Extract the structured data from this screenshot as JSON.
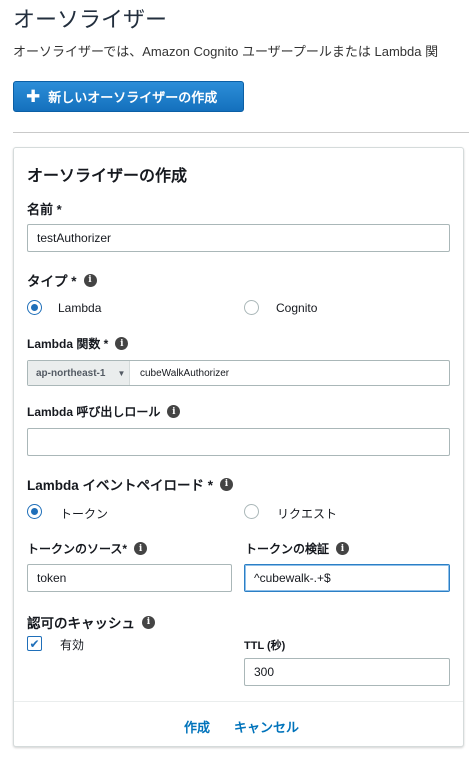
{
  "header": {
    "title": "オーソライザー",
    "description": "オーソライザーでは、Amazon Cognito ユーザープールまたは Lambda 関",
    "new_button_label": "新しいオーソライザーの作成"
  },
  "form": {
    "title": "オーソライザーの作成",
    "name": {
      "label": "名前 *",
      "value": "testAuthorizer"
    },
    "type": {
      "label": "タイプ *",
      "options": [
        "Lambda",
        "Cognito"
      ],
      "selected": "Lambda"
    },
    "lambda_function": {
      "label": "Lambda 関数 *",
      "region": "ap-northeast-1",
      "value": "cubeWalkAuthorizer"
    },
    "invoke_role": {
      "label": "Lambda 呼び出しロール",
      "value": ""
    },
    "event_payload": {
      "label": "Lambda イベントペイロード *",
      "options": [
        "トークン",
        "リクエスト"
      ],
      "selected": "トークン"
    },
    "token_source": {
      "label": "トークンのソース*",
      "value": "token"
    },
    "token_validation": {
      "label": "トークンの検証",
      "value": "^cubewalk-.+$"
    },
    "cache": {
      "label": "認可のキャッシュ",
      "enabled_label": "有効",
      "enabled": true,
      "ttl_label": "TTL (秒)",
      "ttl_value": "300"
    },
    "create_label": "作成",
    "cancel_label": "キャンセル"
  },
  "colors": {
    "primary_button": "#1470bd",
    "link": "#0073bb",
    "radio_selected": "#1f6fb9"
  }
}
